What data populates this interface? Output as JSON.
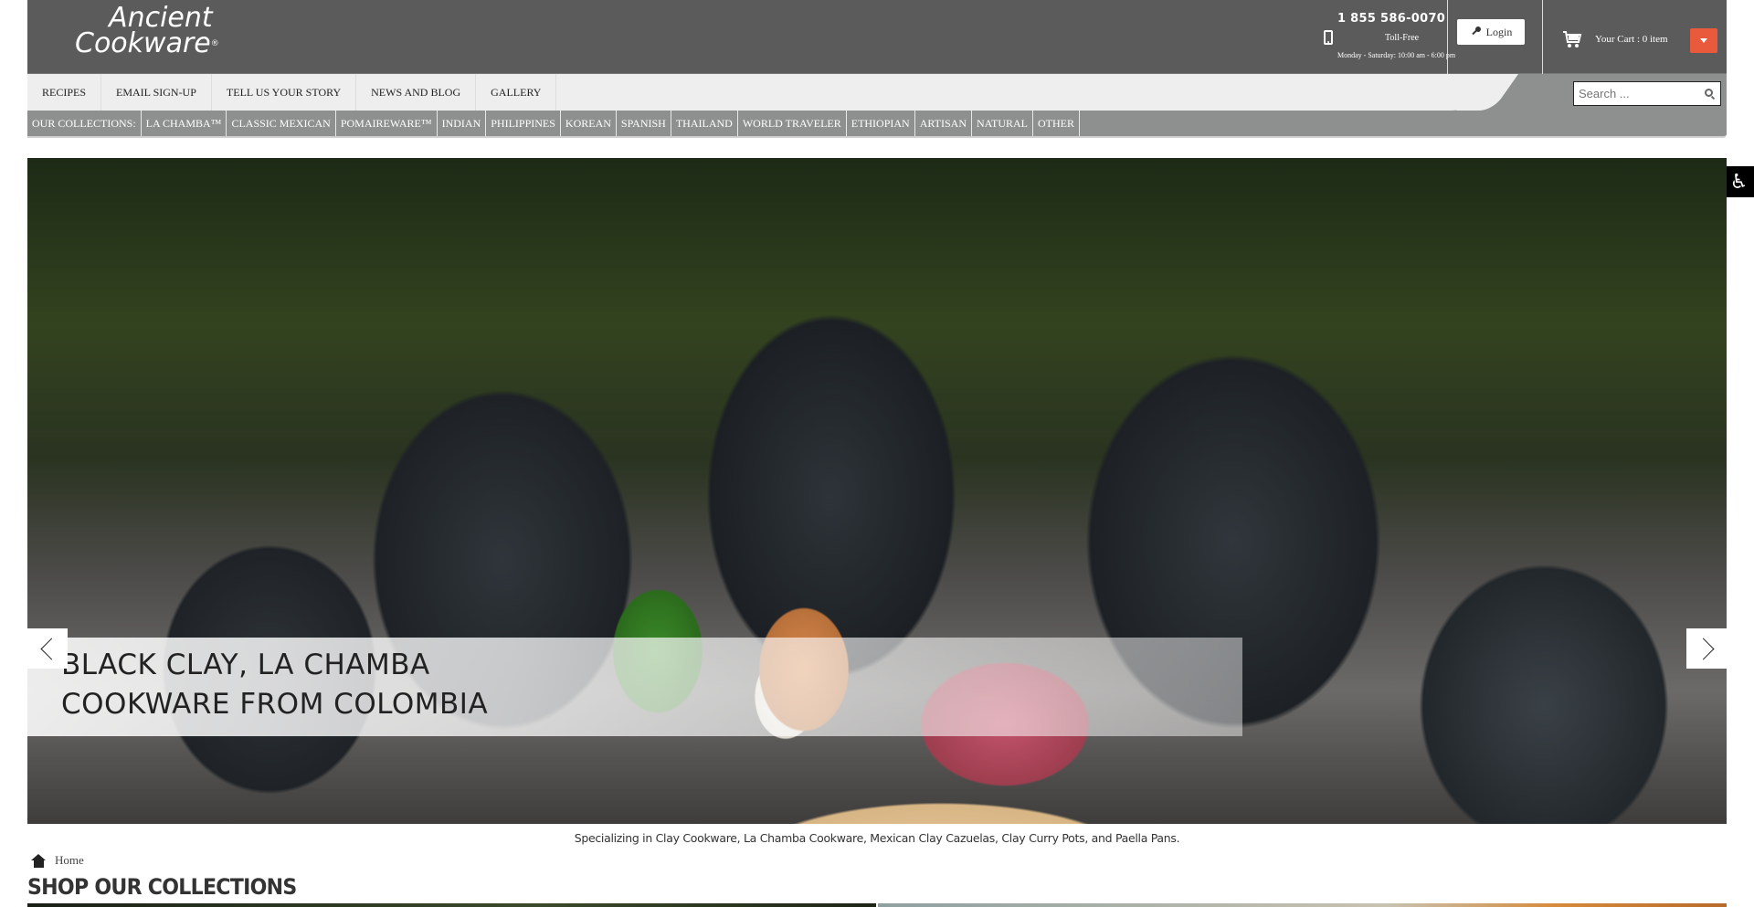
{
  "header": {
    "logo_line1": "Ancient",
    "logo_line2": "Cookware",
    "logo_mark": "®",
    "phone": "1 855 586-0070",
    "phone_label": "Toll-Free",
    "hours": "Monday - Saturday: 10:00 am - 6:00 pm",
    "login_label": "Login",
    "cart_label": "Your Cart : 0 item",
    "accent_color": "#e9593b"
  },
  "main_nav": {
    "items": [
      "RECIPES",
      "EMAIL SIGN-UP",
      "TELL US YOUR STORY",
      "NEWS AND BLOG",
      "GALLERY"
    ],
    "search_placeholder": "Search ..."
  },
  "collections_nav": {
    "label": "OUR COLLECTIONS:",
    "items": [
      "LA CHAMBA™",
      "CLASSIC MEXICAN",
      "POMAIREWARE™",
      "INDIAN",
      "PHILIPPINES",
      "KOREAN",
      "SPANISH",
      "THAILAND",
      "WORLD TRAVELER",
      "ETHIOPIAN",
      "ARTISAN",
      "NATURAL",
      "OTHER"
    ]
  },
  "accessibility": {
    "icon": "♿"
  },
  "hero": {
    "caption_line1": "BLACK CLAY, LA CHAMBA",
    "caption_line2": "COOKWARE FROM COLOMBIA"
  },
  "tagline": "Specializing in Clay Cookware, La Chamba Cookware, Mexican Clay Cazuelas, Clay Curry Pots, and Paella Pans.",
  "breadcrumb": {
    "home": "Home"
  },
  "section": {
    "title": "SHOP OUR COLLECTIONS"
  }
}
